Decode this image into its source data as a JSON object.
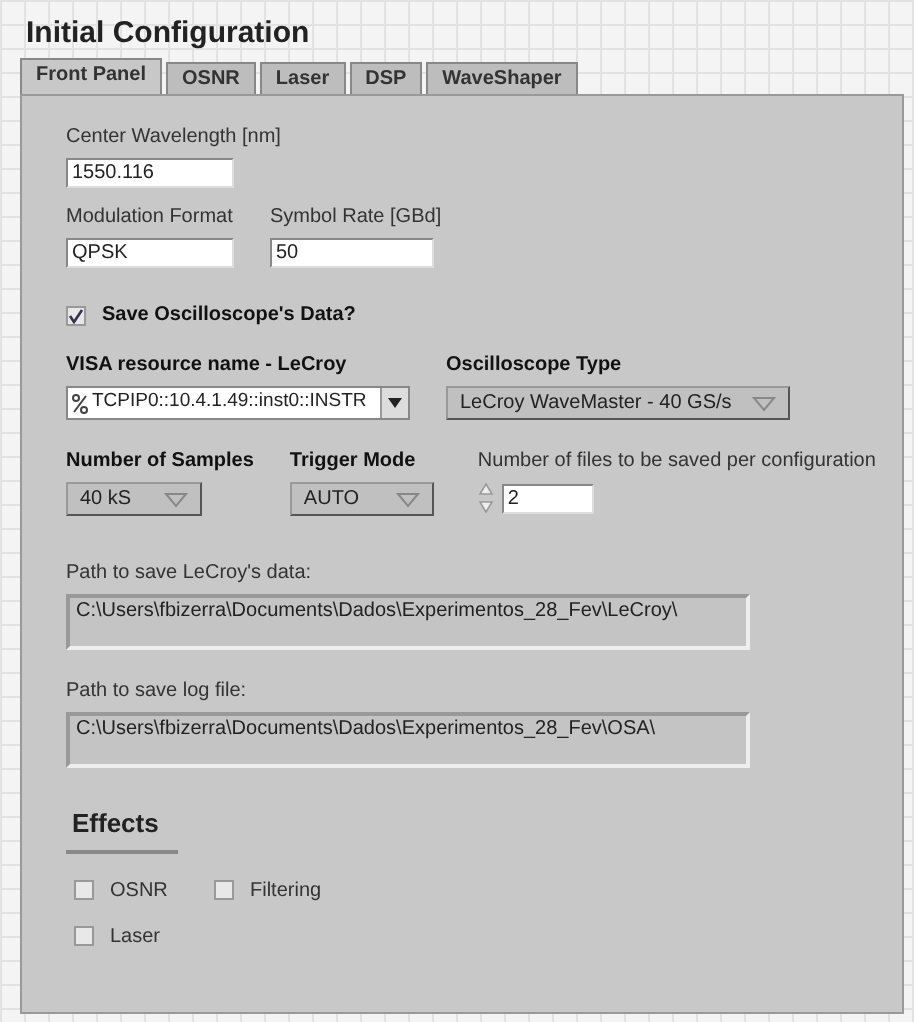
{
  "window": {
    "title": "Initial Configuration"
  },
  "tabs": [
    {
      "label": "Front Panel",
      "selected": true
    },
    {
      "label": "OSNR",
      "selected": false
    },
    {
      "label": "Laser",
      "selected": false
    },
    {
      "label": "DSP",
      "selected": false
    },
    {
      "label": "WaveShaper",
      "selected": false
    }
  ],
  "center_wavelength": {
    "label": "Center Wavelength [nm]",
    "value": "1550.116"
  },
  "modulation_format": {
    "label": "Modulation Format",
    "value": "QPSK"
  },
  "symbol_rate": {
    "label": "Symbol Rate [GBd]",
    "value": "50"
  },
  "save_oscilloscope": {
    "label": "Save Oscilloscope's Data?",
    "checked": true
  },
  "visa_resource": {
    "label": "VISA resource name - LeCroy",
    "value": "TCPIP0::10.4.1.49::inst0::INSTR"
  },
  "oscilloscope_type": {
    "label": "Oscilloscope Type",
    "value": "LeCroy WaveMaster - 40 GS/s"
  },
  "number_of_samples": {
    "label": "Number of Samples",
    "value": "40 kS"
  },
  "trigger_mode": {
    "label": "Trigger Mode",
    "value": "AUTO"
  },
  "files_per_configuration": {
    "label": "Number of files to be saved per configuration",
    "value": "2"
  },
  "lecroy_path": {
    "label": "Path to save LeCroy's data:",
    "value": "C:\\Users\\fbizerra\\Documents\\Dados\\Experimentos_28_Fev\\LeCroy\\"
  },
  "log_path": {
    "label": "Path to save log file:",
    "value": "C:\\Users\\fbizerra\\Documents\\Dados\\Experimentos_28_Fev\\OSA\\"
  },
  "effects": {
    "title": "Effects",
    "options": [
      {
        "label": "OSNR",
        "checked": false
      },
      {
        "label": "Filtering",
        "checked": false
      },
      {
        "label": "Laser",
        "checked": false
      }
    ]
  }
}
